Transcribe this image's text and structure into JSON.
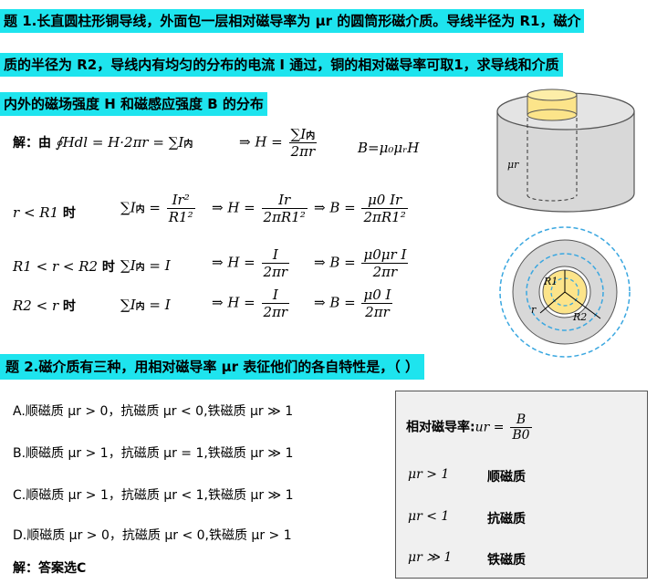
{
  "q1": {
    "line1": "题 1.长直圆柱形铜导线，外面包一层相对磁导率为 μr 的圆筒形磁介质。导线半径为 R1，磁介",
    "line2": "质的半径为 R2，导线内有均匀的分布的电流 I 通过，铜的相对磁导率可取1，求导线和介质",
    "line3": "内外的磁场强度 H 和磁感应强度 B 的分布"
  },
  "solution1": {
    "label": "解：由",
    "ampere_lhs": "∮Hdl = H·2πr = ∑I",
    "arrow_H": "⇒ H =",
    "sumI": "∑I",
    "two_pi_r": "2πr",
    "B_rel": "B=μ₀μᵣH",
    "sub_in": "内",
    "rows": [
      {
        "cond": "r < R1",
        "word": "时",
        "sum": "∑I",
        "sum_rhs_num": "Ir²",
        "sum_rhs_den": "R1²",
        "H_num": "Ir",
        "H_den": "2πR1²",
        "B_num": "μ0 Ir",
        "B_den": "2πR1²"
      },
      {
        "cond": "R1 < r < R2",
        "word": "时",
        "sum": "∑I",
        "sum_rhs": "= I",
        "H_num": "I",
        "H_den": "2πr",
        "B_num": "μ0μr I",
        "B_den": "2πr"
      },
      {
        "cond": "R2 < r",
        "word": "时",
        "sum": "∑I",
        "sum_rhs": "= I",
        "H_num": "I",
        "H_den": "2πr",
        "B_num": "μ0 I",
        "B_den": "2πr"
      }
    ]
  },
  "figure": {
    "mu_label": "μr",
    "r_label": "r",
    "R1_label": "R1",
    "R2_label": "R2"
  },
  "q2": {
    "title": "题 2.磁介质有三种，用相对磁导率 μr 表征他们的各自特性是，（ ）",
    "options": [
      "A.顺磁质 μr > 0，抗磁质 μr < 0,铁磁质 μr ≫ 1",
      "B.顺磁质 μr > 1，抗磁质 μr = 1,铁磁质 μr ≫ 1",
      "C.顺磁质 μr > 1，抗磁质 μr < 1,铁磁质 μr ≫ 1",
      "D.顺磁质 μr > 0，抗磁质 μr < 0,铁磁质 μr > 1"
    ],
    "answer": "解：答案选C"
  },
  "box": {
    "formula_label": "相对磁导率:",
    "formula": "ur =",
    "formula_num": "B",
    "formula_den": "B0",
    "rows": [
      {
        "cond": "μr > 1",
        "name": "顺磁质"
      },
      {
        "cond": "μr < 1",
        "name": "抗磁质"
      },
      {
        "cond": "μr ≫ 1",
        "name": "铁磁质"
      }
    ]
  },
  "colors": {
    "highlight": "#1ee4ee",
    "copper": "#fce48a",
    "medium": "#d8d8d8",
    "dashed": "#3aa7e0"
  }
}
